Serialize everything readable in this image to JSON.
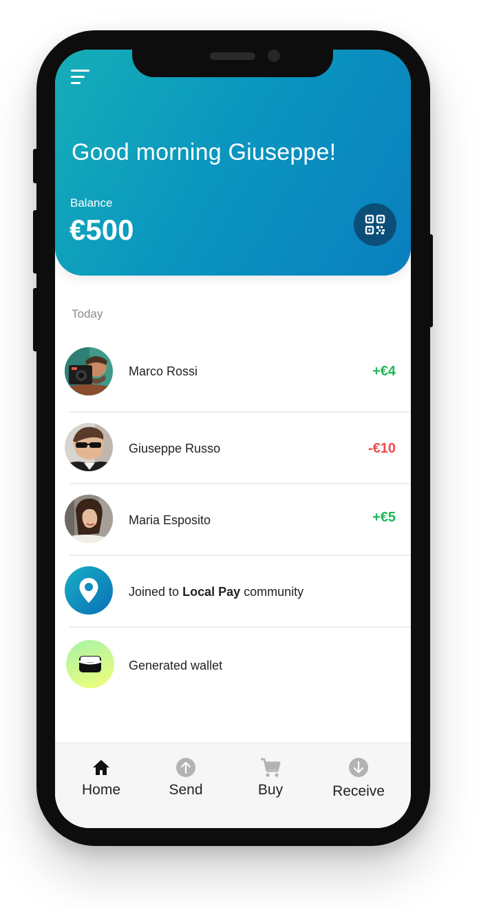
{
  "header": {
    "greeting": "Good morning Giuseppe!",
    "balance_label": "Balance",
    "balance_value": "€500",
    "gradient_start": "#16aeb8",
    "gradient_end": "#0a7fbf",
    "icons": {
      "menu": "hamburger-menu-icon",
      "qr": "qr-code-icon"
    }
  },
  "activity": {
    "section_label": "Today",
    "items": [
      {
        "name": "Marco Rossi",
        "amount": "+€4",
        "type": "positive",
        "icon": "avatar-photo"
      },
      {
        "name": "Giuseppe Russo",
        "amount": "-€10",
        "type": "negative",
        "icon": "avatar-photo"
      },
      {
        "name": "Maria Esposito",
        "amount": "+€5",
        "type": "positive",
        "icon": "avatar-photo"
      },
      {
        "prefix": "Joined to",
        "highlight": "Local Pay",
        "suffix": "community",
        "icon": "location-pin-icon"
      },
      {
        "name": "Generated wallet",
        "icon": "wallet-icon"
      }
    ],
    "colors": {
      "positive": "#1eb854",
      "negative": "#f04b4b"
    }
  },
  "nav": {
    "items": [
      {
        "label": "Home",
        "icon": "home-icon",
        "active": true
      },
      {
        "label": "Send",
        "icon": "arrow-up-circle-icon"
      },
      {
        "label": "Buy",
        "icon": "cart-icon"
      },
      {
        "label": "Receive",
        "icon": "arrow-down-circle-icon"
      }
    ]
  }
}
